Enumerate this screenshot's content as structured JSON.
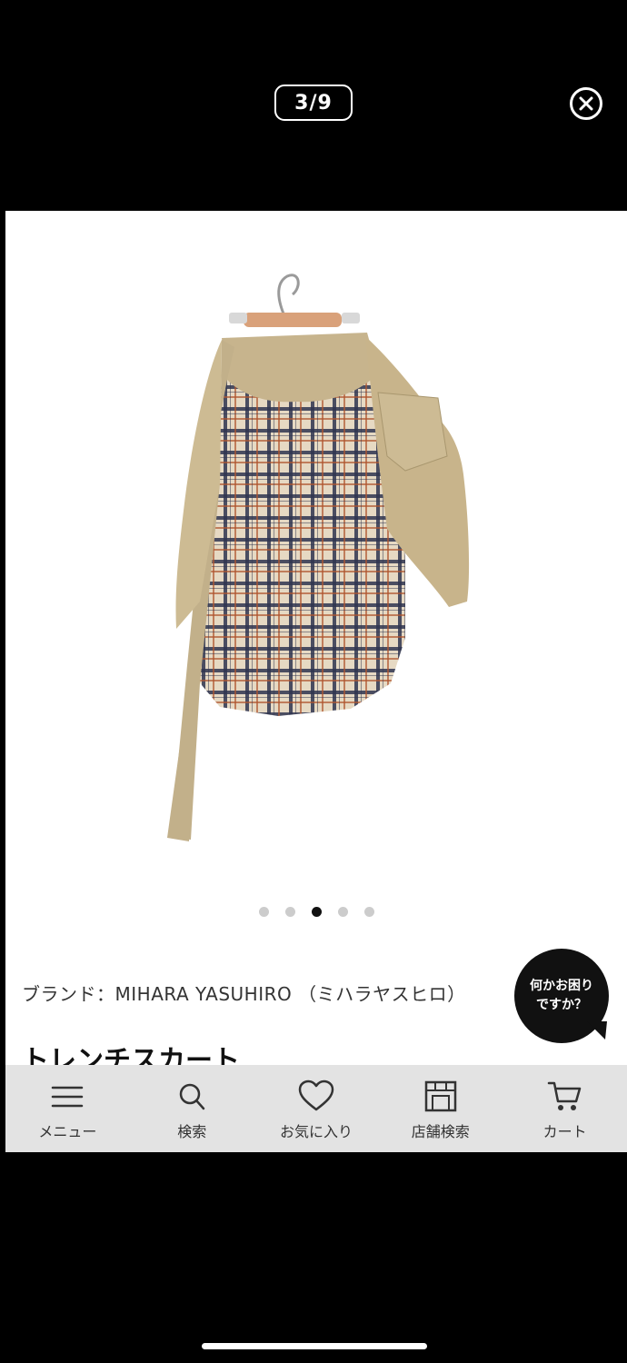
{
  "viewer": {
    "counter": "3/9"
  },
  "gallery": {
    "total_dots": 5,
    "active_index": 3
  },
  "product": {
    "brand_line": "ブランド：MIHARA YASUHIRO （ミハラヤスヒロ）",
    "title": "トレンチスカート"
  },
  "help": {
    "line1": "何かお困り",
    "line2": "ですか？"
  },
  "tabs": [
    {
      "label": "メニュー",
      "icon": "menu-icon"
    },
    {
      "label": "検索",
      "icon": "search-icon"
    },
    {
      "label": "お気に入り",
      "icon": "heart-icon"
    },
    {
      "label": "店舗検索",
      "icon": "store-icon"
    },
    {
      "label": "カート",
      "icon": "cart-icon"
    }
  ]
}
